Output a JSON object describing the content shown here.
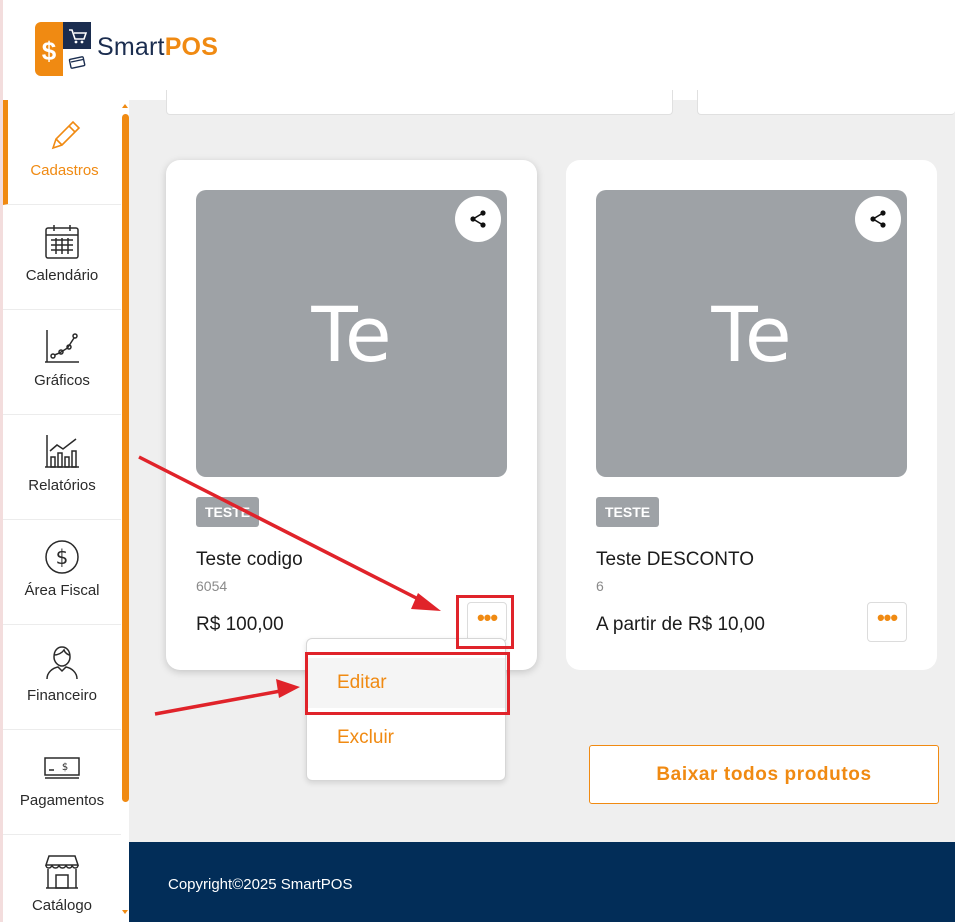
{
  "brand": {
    "name_part1": "Smart",
    "name_part2": "POS"
  },
  "sidebar": {
    "items": [
      {
        "label": "Cadastros",
        "icon": "pencil-icon",
        "active": true
      },
      {
        "label": "Calendário",
        "icon": "calendar-icon"
      },
      {
        "label": "Gráficos",
        "icon": "line-chart-icon"
      },
      {
        "label": "Relatórios",
        "icon": "bar-chart-icon"
      },
      {
        "label": "Área Fiscal",
        "icon": "dollar-circle-icon"
      },
      {
        "label": "Financeiro",
        "icon": "person-icon"
      },
      {
        "label": "Pagamentos",
        "icon": "banknote-icon"
      },
      {
        "label": "Catálogo",
        "icon": "store-icon"
      }
    ]
  },
  "products": [
    {
      "initials": "Te",
      "badge": "TESTE",
      "name": "Teste codigo",
      "code": "6054",
      "price": "R$ 100,00"
    },
    {
      "initials": "Te",
      "badge": "TESTE",
      "name": "Teste DESCONTO",
      "code": "6",
      "price": "A partir de R$ 10,00"
    }
  ],
  "menu": {
    "edit": "Editar",
    "delete": "Excluir"
  },
  "download_button": "Baixar todos produtos",
  "footer": {
    "copyright": "Copyright©2025 SmartPOS"
  },
  "colors": {
    "accent": "#f08a12",
    "navy": "#022d58",
    "placeholder_gray": "#9ea2a6",
    "annotation_red": "#e0232a"
  }
}
